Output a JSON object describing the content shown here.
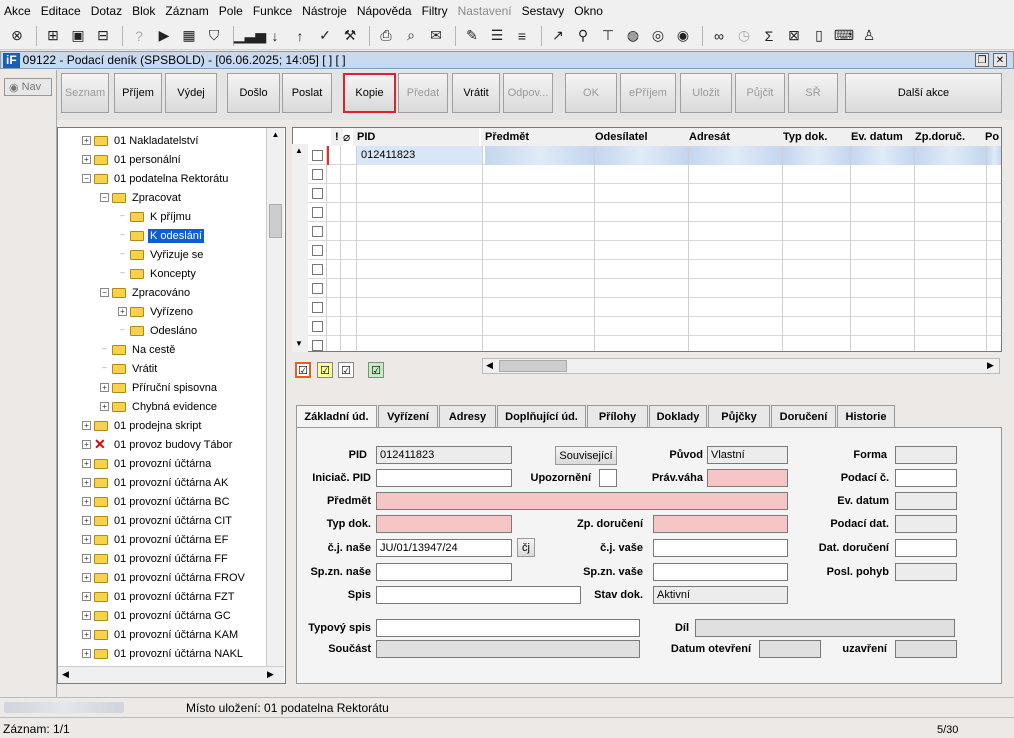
{
  "menu": [
    "Akce",
    "Editace",
    "Dotaz",
    "Blok",
    "Záznam",
    "Pole",
    "Funkce",
    "Nástroje",
    "Nápověda",
    "Filtry",
    "Nastavení",
    "Sestavy",
    "Okno"
  ],
  "menu_disabled": [
    "Nastavení"
  ],
  "window": {
    "logo": "iF",
    "title": "09122 - Podací deník (SPSBOLD) - [06.06.2025; 14:05] [ ] [ ]"
  },
  "nav_label": "Nav",
  "actions": [
    {
      "label": "Seznam",
      "disabled": true
    },
    {
      "label": "Příjem",
      "disabled": false
    },
    {
      "label": "Výdej",
      "disabled": false
    },
    {
      "label": "Došlo",
      "disabled": false
    },
    {
      "label": "Poslat",
      "disabled": false
    },
    {
      "label": "Kopie",
      "disabled": false,
      "highlighted": true
    },
    {
      "label": "Předat",
      "disabled": true
    },
    {
      "label": "Vrátit",
      "disabled": false
    },
    {
      "label": "Odpov...",
      "disabled": true
    },
    {
      "label": "OK",
      "disabled": true
    },
    {
      "label": "ePříjem",
      "disabled": true
    },
    {
      "label": "Uložit",
      "disabled": true
    },
    {
      "label": "Půjčit",
      "disabled": true
    },
    {
      "label": "SŘ",
      "disabled": true
    },
    {
      "label": "Další akce",
      "disabled": false
    }
  ],
  "tree": [
    {
      "label": "01 Nakladatelství",
      "level": 0,
      "expand": "+"
    },
    {
      "label": "01 personální",
      "level": 0,
      "expand": "+"
    },
    {
      "label": "01 podatelna Rektorátu",
      "level": 0,
      "expand": "-"
    },
    {
      "label": "Zpracovat",
      "level": 1,
      "expand": "-"
    },
    {
      "label": "K příjmu",
      "level": 2,
      "expand": ""
    },
    {
      "label": "K odeslání",
      "level": 2,
      "expand": "",
      "selected": true
    },
    {
      "label": "Vyřizuje se",
      "level": 2,
      "expand": ""
    },
    {
      "label": "Koncepty",
      "level": 2,
      "expand": ""
    },
    {
      "label": "Zpracováno",
      "level": 1,
      "expand": "-"
    },
    {
      "label": "Vyřízeno",
      "level": 2,
      "expand": "+"
    },
    {
      "label": "Odesláno",
      "level": 2,
      "expand": ""
    },
    {
      "label": "Na cestě",
      "level": 1,
      "expand": ""
    },
    {
      "label": "Vrátit",
      "level": 1,
      "expand": ""
    },
    {
      "label": "Příruční spisovna",
      "level": 1,
      "expand": "+"
    },
    {
      "label": "Chybná evidence",
      "level": 1,
      "expand": "+"
    },
    {
      "label": "01 prodejna skript",
      "level": 0,
      "expand": "+"
    },
    {
      "label": "01 provoz budovy Tábor",
      "level": 0,
      "expand": "+",
      "xmark": true
    },
    {
      "label": "01 provozní účtárna",
      "level": 0,
      "expand": "+"
    },
    {
      "label": "01 provozní účtárna AK",
      "level": 0,
      "expand": "+"
    },
    {
      "label": "01 provozní účtárna BC",
      "level": 0,
      "expand": "+"
    },
    {
      "label": "01 provozní účtárna CIT",
      "level": 0,
      "expand": "+"
    },
    {
      "label": "01 provozní účtárna EF",
      "level": 0,
      "expand": "+"
    },
    {
      "label": "01 provozní účtárna FF",
      "level": 0,
      "expand": "+"
    },
    {
      "label": "01 provozní účtárna FROV",
      "level": 0,
      "expand": "+"
    },
    {
      "label": "01 provozní účtárna FZT",
      "level": 0,
      "expand": "+"
    },
    {
      "label": "01 provozní účtárna GC",
      "level": 0,
      "expand": "+"
    },
    {
      "label": "01 provozní účtárna KAM",
      "level": 0,
      "expand": "+"
    },
    {
      "label": "01 provozní účtárna NAKL",
      "level": 0,
      "expand": "+"
    }
  ],
  "grid": {
    "headers": [
      "!",
      "PID",
      "Předmět",
      "Odesílatel",
      "Adresát",
      "Typ dok.",
      "Ev. datum",
      "Zp.doruč.",
      "Po"
    ],
    "first_row_pid": "012411823",
    "row_count": 11
  },
  "tabs": [
    "Základní úd.",
    "Vyřízení",
    "Adresy",
    "Doplňující úd.",
    "Přílohy",
    "Doklady",
    "Půjčky",
    "Doručení",
    "Historie"
  ],
  "active_tab": 0,
  "form": {
    "pid_label": "PID",
    "pid": "012411823",
    "souvisejici": "Související",
    "puvod_label": "Původ",
    "puvod": "Vlastní",
    "forma_label": "Forma",
    "iniciac_label": "Iniciač. PID",
    "upozorneni_label": "Upozornění",
    "pravvaha_label": "Práv.váha",
    "podacic_label": "Podací č.",
    "predmet_label": "Předmět",
    "evdatum_label": "Ev. datum",
    "typdok_label": "Typ dok.",
    "zpdoruceni_label": "Zp. doručení",
    "podacidat_label": "Podací dat.",
    "cjnase_label": "č.j. naše",
    "cjnase": "JU/01/13947/24",
    "cj_btn": "čj",
    "cjvase_label": "č.j. vaše",
    "datdoruceni_label": "Dat. doručení",
    "spznnase_label": "Sp.zn. naše",
    "spznvase_label": "Sp.zn. vaše",
    "poslpohyb_label": "Posl. pohyb",
    "spis_label": "Spis",
    "stavdok_label": "Stav dok.",
    "stavdok": "Aktivní",
    "typovyspis_label": "Typový spis",
    "dil_label": "Díl",
    "soucast_label": "Součást",
    "datumotevreni_label": "Datum otevření",
    "uzavreni_label": "uzavření"
  },
  "status": {
    "location": "Místo uložení: 01 podatelna Rektorátu",
    "record": "Záznam: 1/1",
    "page": "5/30"
  }
}
